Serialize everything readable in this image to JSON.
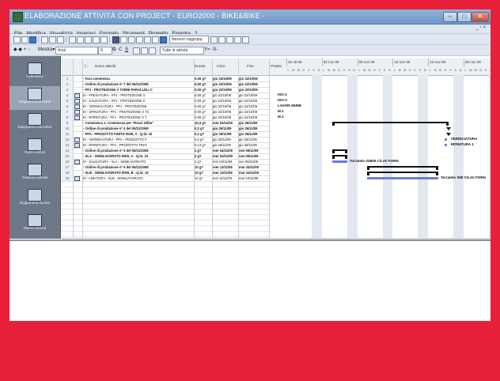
{
  "window": {
    "title": "ELABORAZIONE ATTIVITÀ CON PROJECT - EURO2000 - BIKE&BIKE -",
    "buttons": [
      "–",
      "□",
      "✕"
    ]
  },
  "menu": [
    "File",
    "Modifica",
    "Visualizza",
    "Inserisci",
    "Formato",
    "Strumenti",
    "Progetto",
    "Finestra",
    "?"
  ],
  "menu_right": "_ ▫ ×",
  "toolbar1": {
    "group_combo": "Nessun raggrupp.",
    "zoom_label": ""
  },
  "toolbar2": {
    "font": "Arial",
    "size": "8",
    "filter_combo": "Tutte le attività",
    "extra": "Y= -S-"
  },
  "viewbar": [
    {
      "label": "Calendario",
      "icon": "calendar-icon"
    },
    {
      "label": "Diagramma di Gantt",
      "icon": "gantt-icon"
    },
    {
      "label": "Diagramma reticolare",
      "icon": "network-icon"
    },
    {
      "label": "Gantt verifica",
      "icon": "tracking-gantt-icon"
    },
    {
      "label": "Gestione attività",
      "icon": "task-usage-icon"
    },
    {
      "label": "Diagramma risorse",
      "icon": "resource-graph-icon"
    },
    {
      "label": "Elenco risorse",
      "icon": "resource-sheet-icon"
    }
  ],
  "table": {
    "headers": {
      "id": "",
      "ind": "ⓘ",
      "name": "Nome attività",
      "duration": "Durata",
      "start": "Inizio",
      "finish": "Fine",
      "pred": "Predec"
    },
    "rows": [
      {
        "id": "1",
        "name": "− Fasi commessa",
        "dur": "0,00 g?",
        "start": "gio 22/10/09",
        "end": "gio 22/10/09",
        "bold": true,
        "ind": false
      },
      {
        "id": "2",
        "name": "   − Ordine di produzione nº 7 del 05/11/2008",
        "dur": "0,00 g?",
        "start": "gio 22/10/09",
        "end": "gio 22/10/09",
        "bold": true,
        "ind": false
      },
      {
        "id": "3",
        "name": "      − PF1 - PROTEZIONE X TORNI PARALLELI C",
        "dur": "0,00 g?",
        "start": "gio 22/10/09",
        "end": "gio 22/10/09",
        "bold": true,
        "ind": false
      },
      {
        "id": "4",
        "name": "         10 - FRESATURA - PF1 - PROTEZIONE X",
        "dur": "0,00 g?",
        "start": "gio 22/10/09",
        "end": "gio 22/10/09",
        "bold": false,
        "ind": true
      },
      {
        "id": "5",
        "name": "         20 - SALDATURA - PF1 - PROTEZIONE X",
        "dur": "0,00 g?",
        "start": "gio 22/10/09",
        "end": "gio 22/10/09",
        "bold": false,
        "ind": true
      },
      {
        "id": "6",
        "name": "         30 - VERNICIATURA - PF1 - PROTEZIONE",
        "dur": "0,00 g?",
        "start": "gio 22/10/09",
        "end": "gio 22/10/09",
        "bold": false,
        "ind": true
      },
      {
        "id": "7",
        "name": "         50 - SPINATURA - PF1 - PROTEZIONE X TC",
        "dur": "0,00 g?",
        "start": "gio 22/10/09",
        "end": "gio 22/10/09",
        "bold": false,
        "ind": true
      },
      {
        "id": "8",
        "name": "         60 - RIFINITURA - PF1 - PROTEZIONE X T",
        "dur": "0,00 g?",
        "start": "gio 22/10/09",
        "end": "gio 22/10/09",
        "bold": false,
        "ind": true
      },
      {
        "id": "9",
        "name": "− Commessa 1: Commessa per \"Rossi Gilbe\"",
        "dur": "10,3 g?",
        "start": "mer 04/11/09",
        "end": "gio 26/11/09",
        "bold": true,
        "ind": false
      },
      {
        "id": "10",
        "name": "   − Ordine di produzione nº 4 del 05/11/2008",
        "dur": "0,2 g?",
        "start": "gio 26/11/09",
        "end": "gio 26/11/09",
        "bold": true,
        "ind": false
      },
      {
        "id": "11",
        "name": "      − PFA - PRODOTTO FINITO 0000, A - Q.tà: 10",
        "dur": "0,2 g?",
        "start": "gio 26/11/09",
        "end": "gio 26/11/09",
        "bold": true,
        "ind": false
      },
      {
        "id": "12",
        "name": "         30 - VERNICIATURA - PFA - PRODOTTO F",
        "dur": "0,2 g?",
        "start": "gio 26/11/09",
        "end": "gio 26/11/09",
        "bold": false,
        "ind": true
      },
      {
        "id": "13",
        "name": "         40 - RIFINITURA - PFA - PRODOTTO FINIT",
        "dur": "0,14 g?",
        "start": "gio 26/11/09",
        "end": "gio 26/11/09",
        "bold": false,
        "ind": true
      },
      {
        "id": "14",
        "name": "   − Ordine di produzione nº 5 del 05/11/2008",
        "dur": "3 g?",
        "start": "mer 04/11/09",
        "end": "ven 06/11/09",
        "bold": true,
        "ind": false
      },
      {
        "id": "15",
        "name": "      − SLA - SEMILAVORATO 0000, A - Q.tà: 10",
        "dur": "3 g?",
        "start": "mer 04/11/09",
        "end": "ven 06/11/09",
        "bold": true,
        "ind": false
      },
      {
        "id": "16",
        "name": "         20 - SALDATURA - SLA - SEMILAVORATO",
        "dur": "3 g?",
        "start": "mer 04/11/09",
        "end": "ven 06/11/09",
        "bold": false,
        "ind": true
      },
      {
        "id": "17",
        "name": "   − Ordine di produzione nº 6 del 05/11/2008",
        "dur": "10 g?",
        "start": "mer 11/11/09",
        "end": "mar 24/11/09",
        "bold": true,
        "ind": false
      },
      {
        "id": "18",
        "name": "      − SLB - SEMILAVORATO 0000, B - Q.tà: 10",
        "dur": "10 g?",
        "start": "mer 11/11/09",
        "end": "mar 24/11/09",
        "bold": true,
        "ind": false
      },
      {
        "id": "19",
        "name": "         20 - LIMATURA - SLB - SEMILAVORATO",
        "dur": "10 g?",
        "start": "mer 11/11/09",
        "end": "mar 24/11/09",
        "bold": false,
        "ind": true
      }
    ],
    "predecessors": [
      "",
      "",
      "",
      "ISO-1",
      "ISO-2",
      "LAVOR.SERIE",
      "M.1",
      "M.1"
    ]
  },
  "gantt": {
    "weeks": [
      "26 ott 09",
      "02 nov 09",
      "09 nov 09",
      "16 nov 09",
      "23 nov 09",
      "30 nov 09"
    ],
    "days": [
      "L",
      "M",
      "M",
      "G",
      "V",
      "S",
      "D"
    ],
    "labels": {
      "r12": "VERNICIATURA",
      "r13": "RIFINITURA 1",
      "r16": "Torratelo ISM05 C/LAV FORN",
      "r19": "Torratelo SMI C/LAV FORN"
    }
  }
}
